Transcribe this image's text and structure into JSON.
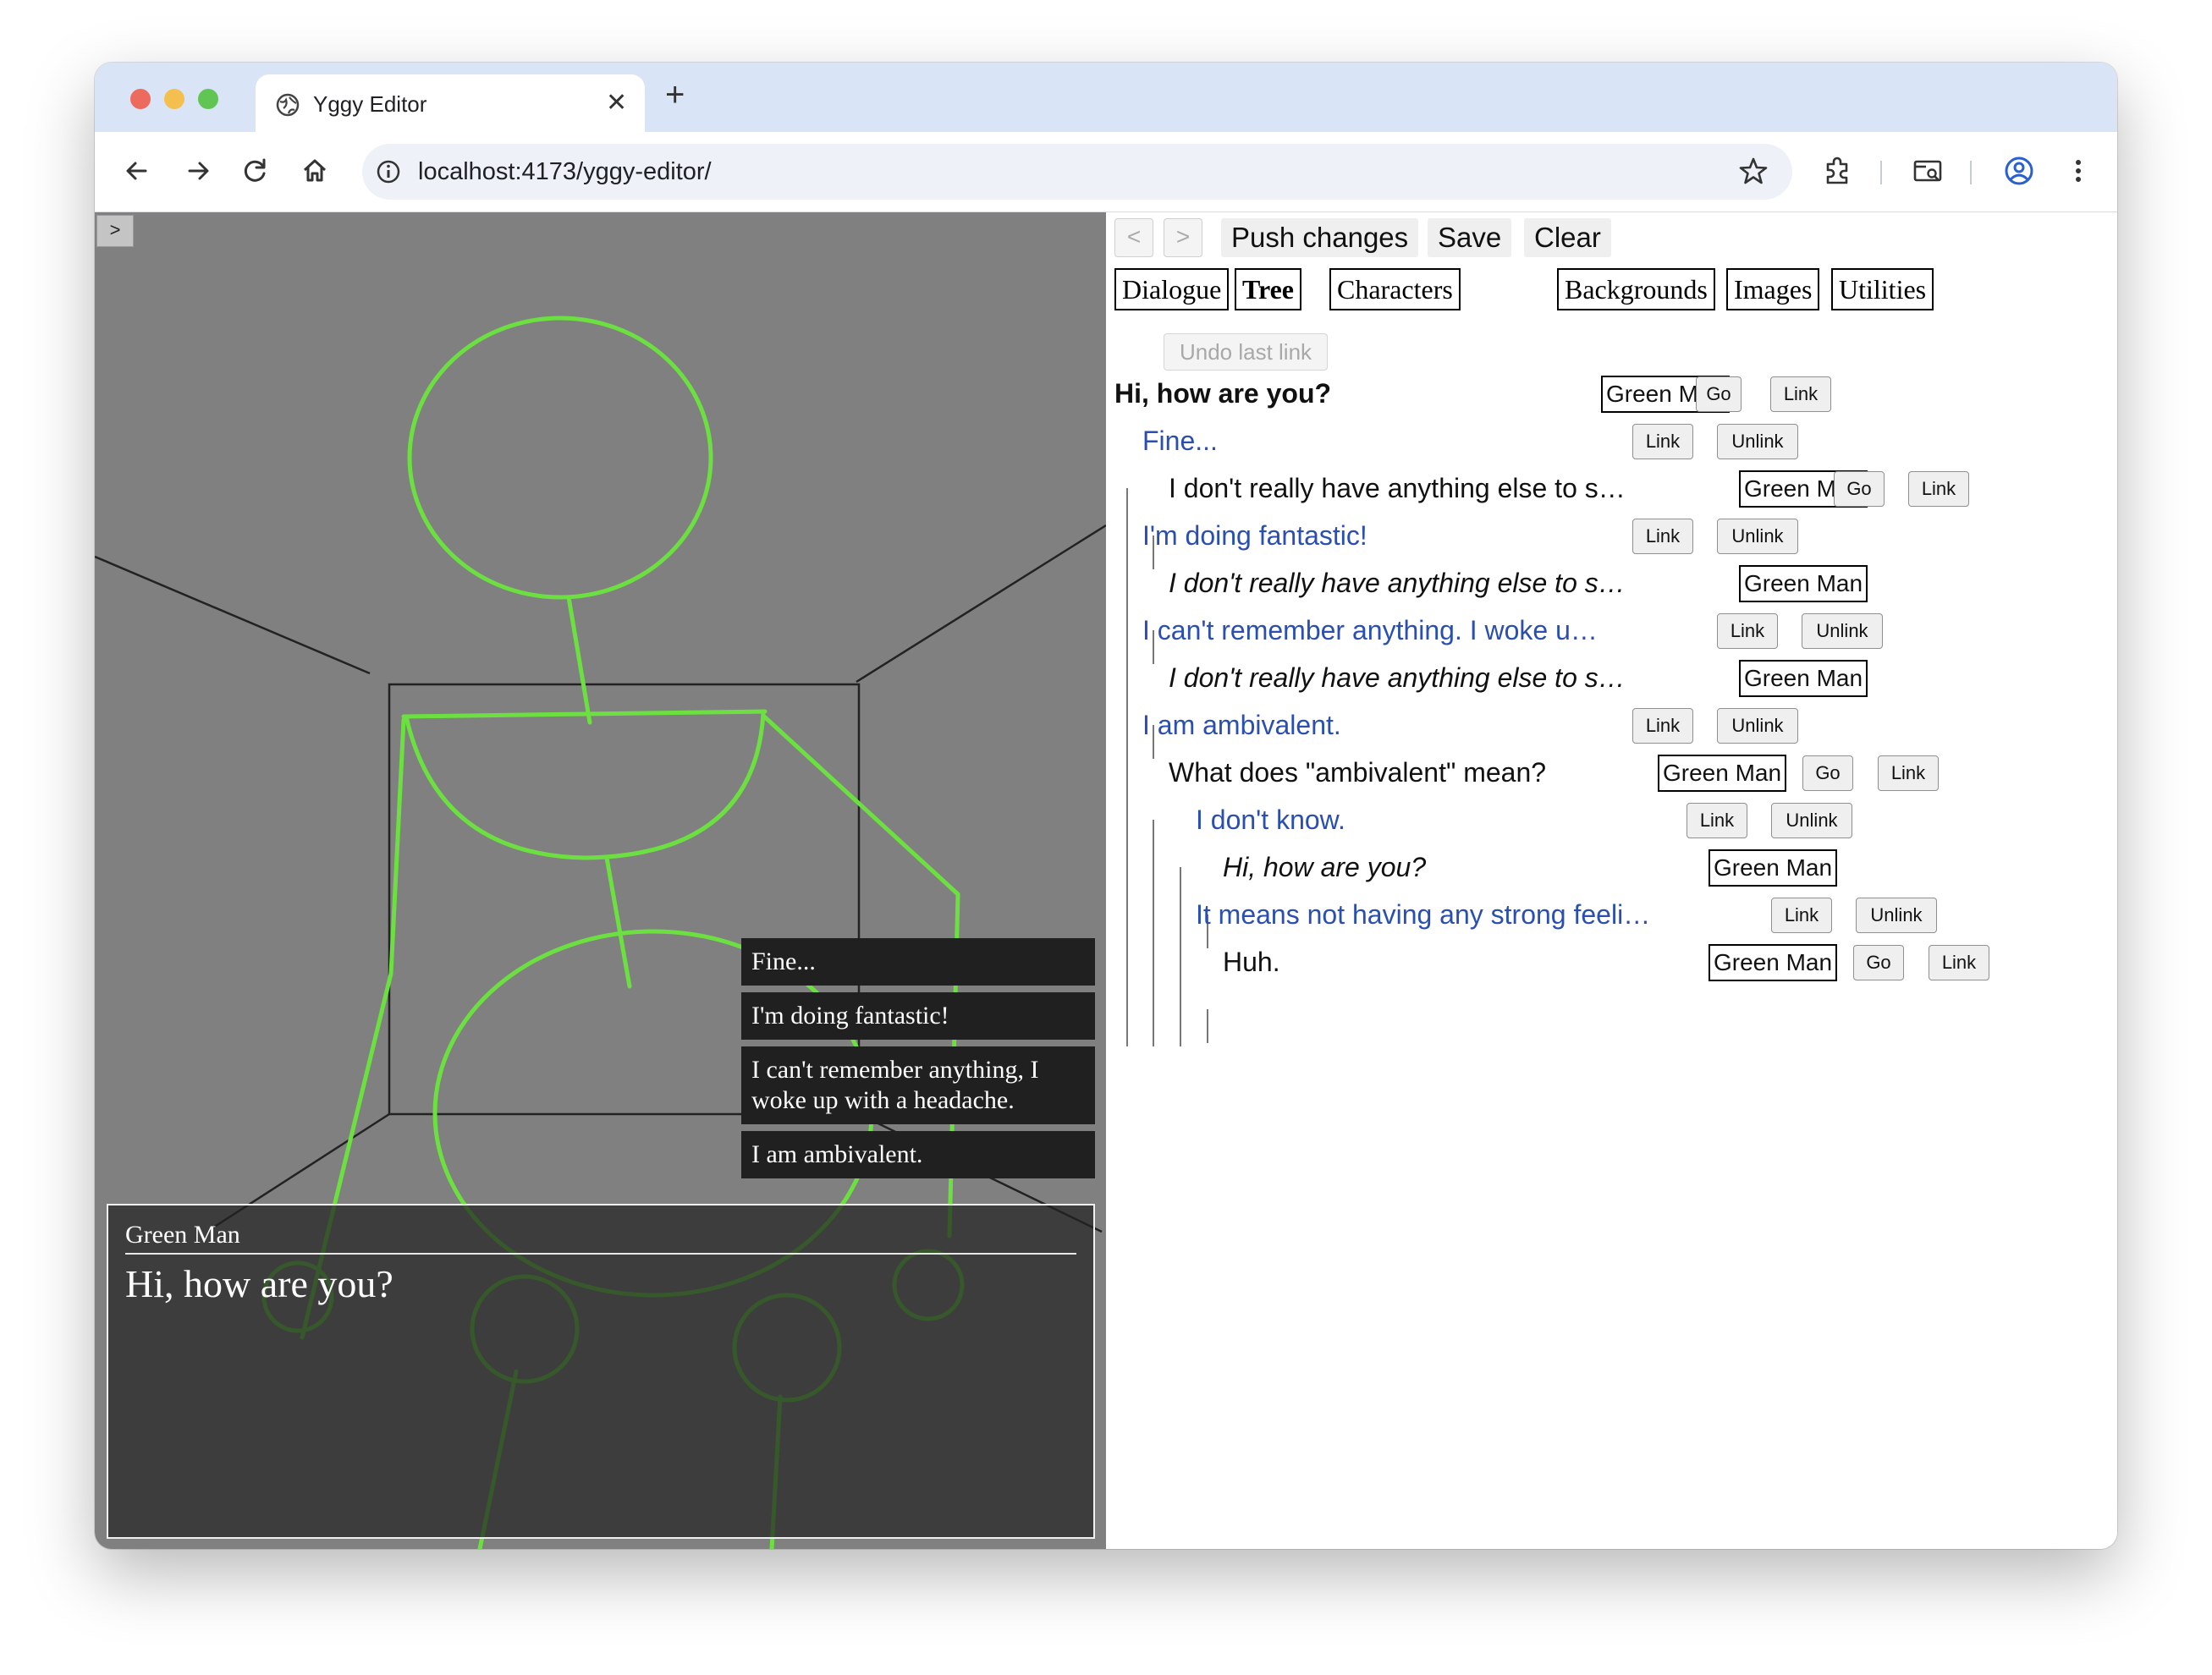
{
  "browser": {
    "tab_title": "Yggy Editor",
    "url": "localhost:4173/yggy-editor/"
  },
  "game": {
    "toggle_label": ">",
    "choices": [
      "Fine...",
      "I'm doing fantastic!",
      "I can't remember anything, I woke up with a headache.",
      "I am ambivalent."
    ],
    "speaker": "Green Man",
    "line": "Hi, how are you?"
  },
  "editor": {
    "prev_label": "<",
    "next_label": ">",
    "push_label": "Push changes",
    "save_label": "Save",
    "clear_label": "Clear",
    "tabs": [
      "Dialogue",
      "Tree",
      "Characters",
      "Backgrounds",
      "Images",
      "Utilities"
    ],
    "active_tab": "Tree",
    "undo_label": "Undo last link",
    "go_label": "Go",
    "link_label": "Link",
    "unlink_label": "Unlink",
    "tree": [
      {
        "kind": "line",
        "text": "Hi, how are you?",
        "character": "Green Man"
      },
      {
        "kind": "choice",
        "text": "Fine..."
      },
      {
        "kind": "line",
        "text": "I don't really have anything else to s…",
        "character": "Green Man"
      },
      {
        "kind": "choice",
        "text": "I'm doing fantastic!"
      },
      {
        "kind": "link",
        "text": "I don't really have anything else to s…",
        "character": "Green Man"
      },
      {
        "kind": "choice",
        "text": "I can't remember anything. I woke u…"
      },
      {
        "kind": "link",
        "text": "I don't really have anything else to s…",
        "character": "Green Man"
      },
      {
        "kind": "choice",
        "text": "I am ambivalent."
      },
      {
        "kind": "line",
        "text": "What does \"ambivalent\" mean?",
        "character": "Green Man"
      },
      {
        "kind": "choice",
        "text": "I don't know."
      },
      {
        "kind": "link",
        "text": "Hi, how are you?",
        "character": "Green Man"
      },
      {
        "kind": "choice",
        "text": "It means not having any strong feeli…"
      },
      {
        "kind": "line",
        "text": "Huh.",
        "character": "Green Man"
      }
    ]
  },
  "colors": {
    "stickman": "#6ce040",
    "choice_text": "#2a4fb0",
    "game_background": "#808080"
  }
}
